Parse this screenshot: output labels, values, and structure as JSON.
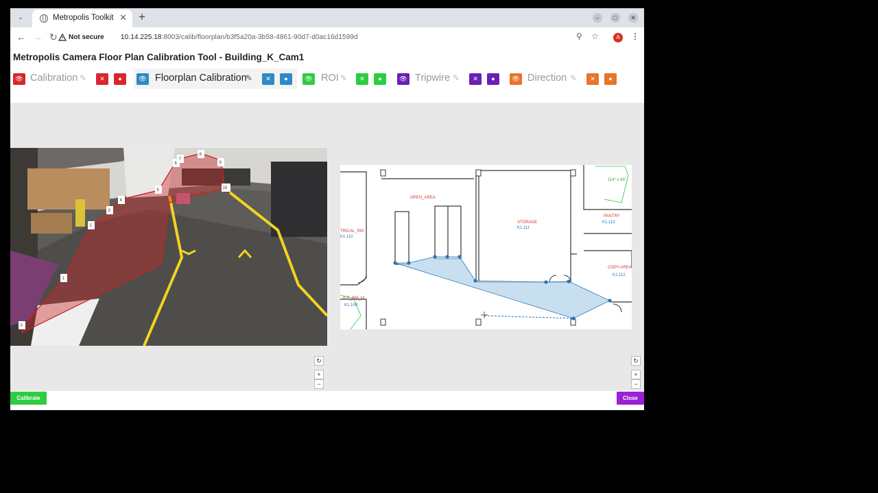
{
  "browser": {
    "tab_title": "Metropolis Toolkit",
    "security_label": "Not secure",
    "url_host": "10.14.225.18",
    "url_path": ":8003/calib/floorplan/b3f5a20a-3b58-4861-90d7-d0ac16d1599d",
    "profile_initial": "A"
  },
  "app": {
    "title": "Metropolis Camera Floor Plan Calibration Tool - Building_K_Cam1"
  },
  "toolbar": {
    "groups": [
      {
        "label": "Calibration",
        "color": "#d9272e",
        "active": false
      },
      {
        "label": "Floorplan Calibration",
        "color": "#2f8ac4",
        "active": true
      },
      {
        "label": "ROI",
        "color": "#2ecc40",
        "active": false
      },
      {
        "label": "Tripwire",
        "color": "#6a1fb5",
        "active": false
      },
      {
        "label": "Direction",
        "color": "#e8742a",
        "active": false
      }
    ]
  },
  "camera": {
    "point_labels": [
      "0",
      "1",
      "2",
      "3",
      "4",
      "5",
      "6",
      "7",
      "8",
      "9",
      "10"
    ]
  },
  "floorplan": {
    "rooms": [
      {
        "name": "OPEN_AREA",
        "id": ""
      },
      {
        "name": "STORAGE",
        "id": "K1.111"
      },
      {
        "name": "PANTRY",
        "id": "K1.113"
      },
      {
        "name": "COPY-AREA",
        "id": "K1.112"
      },
      {
        "name": "TRICAL_RM",
        "id": "K1.110"
      },
      {
        "name": "ICE_RM_M",
        "id": "K1.108"
      },
      {
        "name": "",
        "id": "114\" x 43\""
      }
    ]
  },
  "controls": {
    "reset_icon": "↻",
    "zoom_in": "+",
    "zoom_out": "−"
  },
  "footer": {
    "calibrate_label": "Calibrate",
    "close_label": "Close",
    "calibrate_color": "#2ecc40",
    "close_color": "#9b1fd6"
  }
}
